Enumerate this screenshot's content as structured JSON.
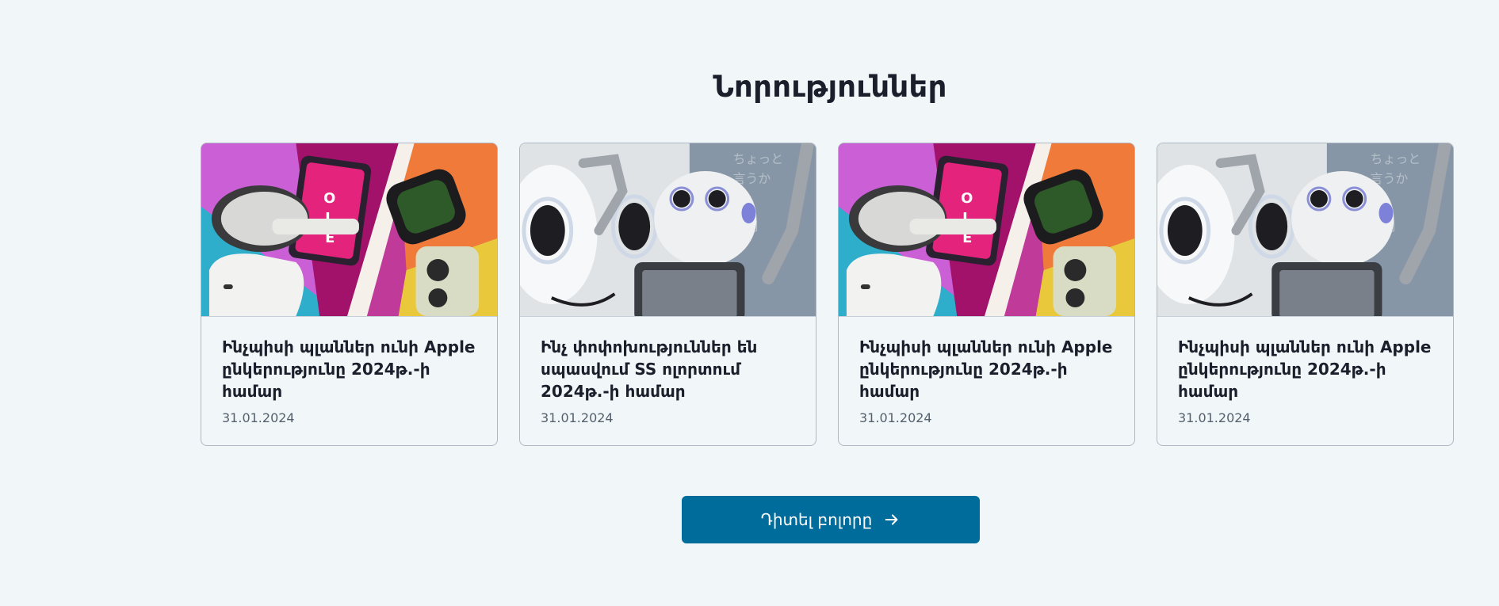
{
  "news": {
    "title": "Նորություններ",
    "cards": [
      {
        "title": "Ինչպիսի պլաններ ունի Apple ընկերությունը 2024թ.-ի համար",
        "date": "31.01.2024",
        "image": "apple-products-collage"
      },
      {
        "title": "Ինչ փոփոխություններ են սպասվում SS ոլորտում 2024թ.-ի համար",
        "date": "31.01.2024",
        "image": "humanoid-robot"
      },
      {
        "title": "Ինչպիսի պլաններ ունի Apple ընկերությունը 2024թ.-ի համար",
        "date": "31.01.2024",
        "image": "apple-products-collage"
      },
      {
        "title": "Ինչպիսի պլաններ ունի Apple ընկերությունը 2024թ.-ի համար",
        "date": "31.01.2024",
        "image": "humanoid-robot"
      }
    ],
    "view_all_label": "Դիտել բոլորը"
  },
  "colors": {
    "background": "#f1f6f9",
    "button": "#006c9c",
    "title_text": "#1a1f2b",
    "date_text": "#55606d"
  }
}
